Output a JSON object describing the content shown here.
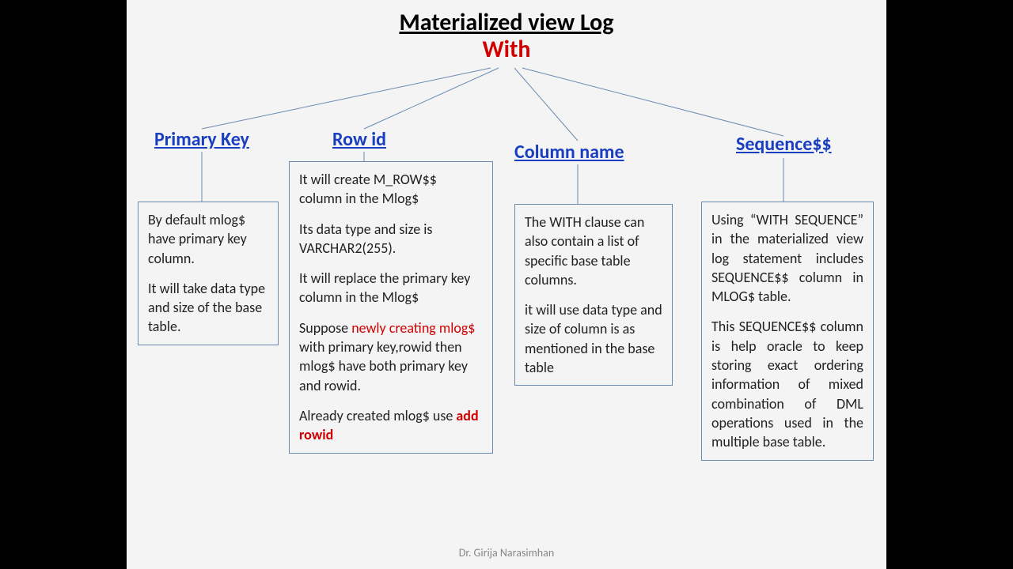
{
  "title": "Materialized  view Log",
  "with_label": "With",
  "branches": {
    "primary_key": {
      "heading": "Primary Key"
    },
    "row_id": {
      "heading": "Row id"
    },
    "column_name": {
      "heading": "Column name"
    },
    "sequence": {
      "heading": "Sequence$$"
    }
  },
  "boxes": {
    "primary_key": {
      "p1": "By default mlog$ have primary key column.",
      "p2": "It will take data type and size of the base table."
    },
    "row_id": {
      "p1": "It will create  M_ROW$$ column in the Mlog$",
      "p2": "Its data type and size is VARCHAR2(255).",
      "p3": "It will replace the primary key column in the Mlog$",
      "p4a": "Suppose ",
      "p4b": "newly creating mlog$",
      "p4c": " with primary key,rowid then mlog$ have both primary key and rowid.",
      "p5a": "Already created mlog$ use ",
      "p5b": "add rowid"
    },
    "column_name": {
      "p1": "The WITH clause can also contain a list of specific base table columns.",
      "p2": "it will use data type and size of column is as mentioned in the base table"
    },
    "sequence": {
      "p1": "Using “WITH SEQUENCE” in the materialized view log statement includes SEQUENCE$$ column in MLOG$ table.",
      "p2": "This SEQUENCE$$ column is help oracle to keep storing exact ordering information of mixed combination of DML operations used in the multiple base table."
    }
  },
  "footer": "Dr. Girija Narasimhan"
}
